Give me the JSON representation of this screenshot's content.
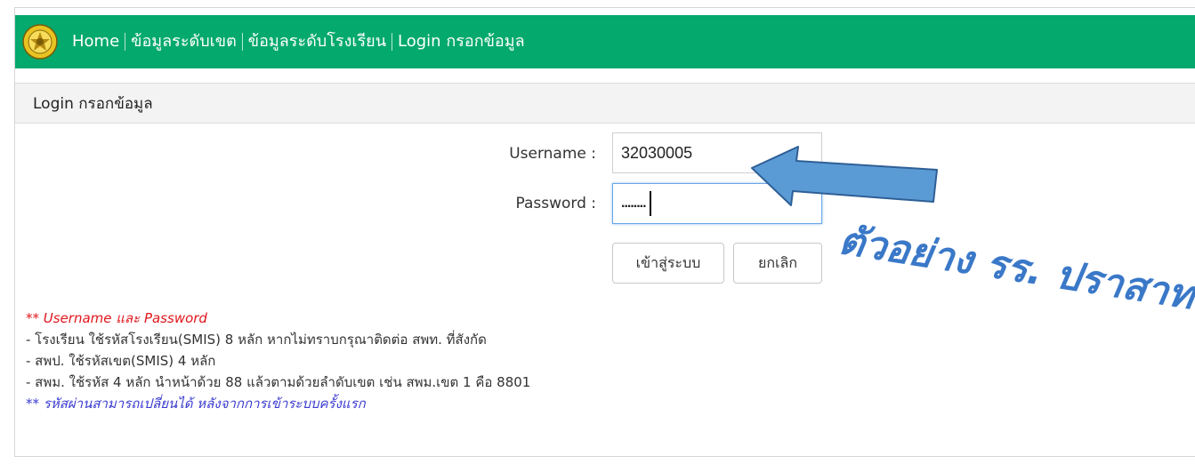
{
  "nav": {
    "items": [
      "Home",
      "ข้อมูลระดับเขต",
      "ข้อมูลระดับโรงเรียน",
      "Login กรอกข้อมูล"
    ]
  },
  "panel": {
    "title": "Login กรอกข้อมูล"
  },
  "form": {
    "username_label": "Username :",
    "username_value": "32030005",
    "password_label": "Password :",
    "password_value": "........",
    "login_button": "เข้าสู่ระบบ",
    "cancel_button": "ยกเลิก"
  },
  "notes": {
    "heading": "** Username และ Password",
    "line1": " - โรงเรียน ใช้รหัสโรงเรียน(SMIS) 8 หลัก หากไม่ทราบกรุณาติดต่อ สพท. ที่สังกัด",
    "line2": " - สพป. ใช้รหัสเขต(SMIS) 4 หลัก",
    "line3": " - สพม. ใช้รหัส 4 หลัก นำหน้าด้วย 88 แล้วตามด้วยลำดับเขต เช่น สพม.เขต 1 คือ 8801",
    "footer": "** รหัสผ่านสามารถเปลี่ยนได้ หลังจากการเข้าระบบครั้งแรก"
  },
  "annotation": {
    "text": "ตัวอย่าง รร. ปราสาท"
  },
  "colors": {
    "navbar": "#04a96e",
    "arrow": "#5b9bd5",
    "annotation": "#3a78c8"
  },
  "icons": {
    "logo": "emblem-logo",
    "arrow": "left-arrow-callout"
  }
}
